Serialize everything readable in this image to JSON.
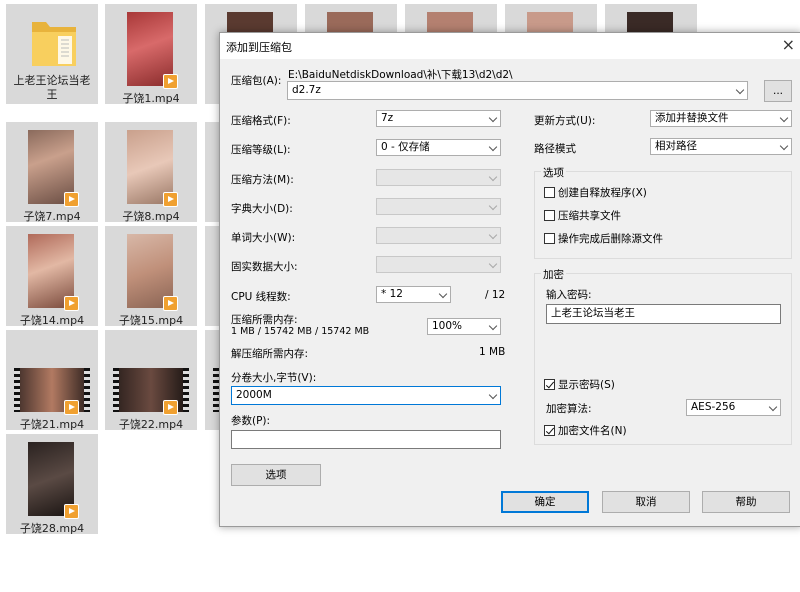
{
  "explorer": {
    "files": [
      {
        "name": "上老王论坛当老\n王",
        "kind": "folder"
      },
      {
        "name": "子饶1.mp4",
        "kind": "video"
      },
      {
        "name": "子饶7.mp4",
        "kind": "video"
      },
      {
        "name": "子饶8.mp4",
        "kind": "video"
      },
      {
        "name": "子饶14.mp4",
        "kind": "video"
      },
      {
        "name": "子饶15.mp4",
        "kind": "video"
      },
      {
        "name": "子饶21.mp4",
        "kind": "video-wide"
      },
      {
        "name": "子饶22.mp4",
        "kind": "video-wide"
      },
      {
        "name": "子饶28.mp4",
        "kind": "video"
      }
    ]
  },
  "dialog": {
    "title": "添加到压缩包",
    "close_icon": "×",
    "archive_label": "压缩包(A):",
    "archive_path": "E:\\BaiduNetdiskDownload\\补\\下载13\\d2\\d2\\",
    "archive_name": "d2.7z",
    "browse_label": "...",
    "format_label": "压缩格式(F):",
    "format_value": "7z",
    "level_label": "压缩等级(L):",
    "level_value": "0 - 仅存储",
    "method_label": "压缩方法(M):",
    "dict_label": "字典大小(D):",
    "word_label": "单词大小(W):",
    "solid_label": "固实数据大小:",
    "cpu_label": "CPU 线程数:",
    "cpu_value": "* 12",
    "cpu_total": "/ 12",
    "mem_comp_label": "压缩所需内存:",
    "mem_comp_detail": "1 MB / 15742 MB / 15742 MB",
    "mem_percent": "100%",
    "mem_decomp_label": "解压缩所需内存:",
    "mem_decomp_value": "1 MB",
    "split_label": "分卷大小,字节(V):",
    "split_value": "2000M",
    "params_label": "参数(P):",
    "params_value": "",
    "options_button": "选项",
    "update_label": "更新方式(U):",
    "update_value": "添加并替换文件",
    "pathmode_label": "路径模式",
    "pathmode_value": "相对路径",
    "options_group": "选项",
    "opt_sfx": "创建自释放程序(X)",
    "opt_shared": "压缩共享文件",
    "opt_delete": "操作完成后删除源文件",
    "encrypt_group": "加密",
    "password_label": "输入密码:",
    "password_value": "上老王论坛当老王",
    "show_password": "显示密码(S)",
    "algo_label": "加密算法:",
    "algo_value": "AES-256",
    "encrypt_names": "加密文件名(N)",
    "ok": "确定",
    "cancel": "取消",
    "help": "帮助"
  }
}
